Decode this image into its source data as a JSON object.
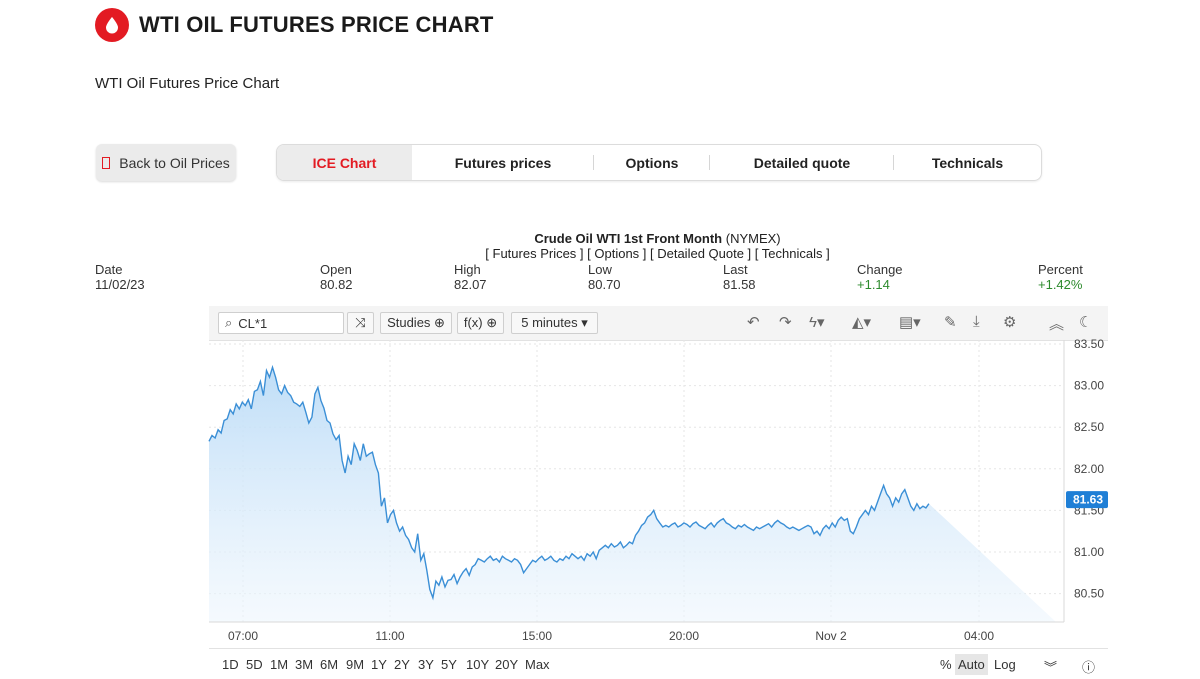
{
  "header": {
    "title": "WTI OIL FUTURES PRICE CHART",
    "subtitle": "WTI Oil Futures Price Chart"
  },
  "nav": {
    "back_label": "Back to Oil Prices",
    "tabs": [
      {
        "label": "ICE Chart",
        "active": true
      },
      {
        "label": "Futures prices",
        "active": false
      },
      {
        "label": "Options",
        "active": false
      },
      {
        "label": "Detailed quote",
        "active": false
      },
      {
        "label": "Technicals",
        "active": false
      }
    ]
  },
  "instrument": {
    "name": "Crude Oil WTI 1st Front Month",
    "exchange": "(NYMEX)",
    "links": "[ Futures Prices ] [ Options ] [ Detailed Quote ] [ Technicals ]"
  },
  "quote": {
    "date_label": "Date",
    "date": "11/02/23",
    "open_label": "Open",
    "open": "80.82",
    "high_label": "High",
    "high": "82.07",
    "low_label": "Low",
    "low": "80.70",
    "last_label": "Last",
    "last": "81.58",
    "change_label": "Change",
    "change": "+1.14",
    "percent_label": "Percent",
    "percent": "+1.42%"
  },
  "toolbar": {
    "symbol": "CL*1",
    "studies_label": "Studies ⊕",
    "fx_label": "f(x) ⊕",
    "interval_label": "5 minutes ▾"
  },
  "bottom": {
    "ranges": [
      "1D",
      "5D",
      "1M",
      "3M",
      "6M",
      "9M",
      "1Y",
      "2Y",
      "3Y",
      "5Y",
      "10Y",
      "20Y",
      "Max"
    ],
    "percent_label": "%",
    "auto_label": "Auto",
    "log_label": "Log"
  },
  "colors": {
    "accent": "#e31b23",
    "line": "#3b8fd6",
    "area": "#cfe5fa",
    "positive": "#2e8b2e"
  },
  "chart_data": {
    "type": "area",
    "x_ticks": [
      "07:00",
      "11:00",
      "15:00",
      "20:00",
      "Nov 2",
      "04:00"
    ],
    "y_ticks": [
      "80.50",
      "81.00",
      "81.50",
      "82.00",
      "82.50",
      "83.00",
      "83.50"
    ],
    "ylim": [
      80.2,
      83.5
    ],
    "last_value": "81.63",
    "x": [
      0,
      2,
      4,
      6,
      8,
      10,
      12,
      14,
      16,
      18,
      20,
      22,
      24,
      26,
      28,
      30,
      32,
      34,
      36,
      38,
      40,
      42,
      44,
      46,
      48,
      50,
      52,
      54,
      56,
      58,
      60,
      62,
      64,
      66,
      68,
      70,
      72,
      74,
      76,
      78,
      80,
      82,
      84,
      86,
      88,
      90,
      92,
      94,
      96,
      98,
      100,
      102,
      104,
      106,
      108,
      110,
      112,
      114,
      116,
      118,
      120,
      122,
      124,
      126,
      128,
      130,
      132,
      134,
      136,
      138,
      140,
      142,
      144,
      146,
      148,
      150,
      152,
      154,
      156,
      158,
      160,
      162,
      164,
      166,
      168,
      170,
      172,
      174,
      176,
      178,
      180,
      182,
      184,
      186,
      188,
      190,
      192,
      194,
      196,
      198,
      200,
      202,
      204,
      206,
      208,
      210,
      212,
      214,
      216,
      218,
      220,
      222,
      224,
      226,
      228,
      230,
      232,
      234,
      236,
      238,
      240,
      242,
      244,
      246,
      248,
      250,
      252,
      254,
      256,
      258,
      260,
      262,
      264,
      266,
      268,
      270,
      272,
      274,
      276,
      278,
      280,
      282,
      284,
      286,
      288,
      290,
      292,
      294,
      296,
      298,
      300,
      302,
      304,
      306,
      308,
      310,
      312,
      314,
      316,
      318,
      320,
      322,
      324,
      326,
      328,
      330,
      332,
      334,
      336,
      338,
      340,
      342,
      344,
      346,
      348,
      350,
      352,
      354,
      356,
      358,
      360,
      362,
      364,
      366,
      368,
      370,
      372,
      374,
      376,
      378,
      380,
      382,
      384,
      386,
      388,
      390,
      392,
      394,
      396,
      398,
      400,
      402,
      404,
      406,
      408,
      410,
      412,
      414,
      416,
      418,
      420,
      422,
      424,
      426,
      428,
      430,
      432,
      434,
      436,
      438,
      440,
      442,
      444,
      446,
      448,
      450,
      452,
      454,
      456,
      458,
      460,
      462,
      464,
      466,
      468,
      470,
      472,
      474,
      476,
      478,
      480,
      482,
      484,
      486,
      488,
      490,
      492,
      494,
      496,
      498,
      500,
      502,
      504,
      506,
      508,
      510,
      512,
      514,
      516,
      518,
      520,
      522,
      524,
      526,
      528,
      530,
      532,
      534,
      536,
      538,
      540,
      542,
      544,
      546,
      548,
      550,
      552,
      554,
      556,
      558,
      560
    ],
    "values": [
      82.33,
      82.4,
      82.37,
      82.47,
      82.43,
      82.58,
      82.6,
      82.71,
      82.66,
      82.78,
      82.72,
      82.8,
      82.76,
      82.83,
      82.72,
      82.93,
      82.95,
      83.05,
      82.88,
      83.18,
      83.1,
      83.22,
      83.1,
      82.95,
      82.9,
      83.0,
      82.92,
      82.88,
      82.8,
      82.78,
      82.75,
      82.8,
      82.68,
      82.55,
      82.62,
      82.9,
      82.98,
      82.82,
      82.73,
      82.58,
      82.55,
      82.42,
      82.35,
      82.4,
      82.1,
      81.95,
      82.15,
      82.05,
      82.3,
      82.22,
      82.1,
      82.3,
      82.15,
      82.18,
      82.2,
      82.05,
      81.95,
      81.55,
      81.65,
      81.35,
      81.45,
      81.5,
      81.35,
      81.25,
      81.3,
      81.2,
      81.15,
      81.05,
      81.0,
      81.22,
      80.9,
      80.98,
      80.78,
      80.55,
      80.45,
      80.65,
      80.6,
      80.7,
      80.58,
      80.66,
      80.67,
      80.73,
      80.62,
      80.7,
      80.76,
      80.8,
      80.72,
      80.82,
      80.85,
      80.92,
      80.9,
      80.88,
      80.92,
      80.95,
      80.9,
      80.92,
      80.88,
      80.95,
      80.92,
      80.9,
      80.88,
      80.92,
      80.9,
      80.85,
      80.75,
      80.8,
      80.85,
      80.9,
      80.88,
      80.92,
      80.95,
      80.9,
      80.92,
      80.95,
      80.9,
      80.88,
      80.92,
      80.9,
      80.95,
      80.92,
      80.98,
      80.95,
      80.92,
      80.95,
      80.9,
      80.98,
      80.95,
      81.0,
      80.92,
      81.02,
      81.05,
      81.08,
      81.05,
      81.1,
      81.06,
      81.08,
      81.12,
      81.05,
      81.08,
      81.12,
      81.1,
      81.2,
      81.25,
      81.32,
      81.35,
      81.42,
      81.45,
      81.5,
      81.4,
      81.35,
      81.3,
      81.32,
      81.3,
      81.33,
      81.35,
      81.3,
      81.32,
      81.35,
      81.33,
      81.3,
      81.34,
      81.36,
      81.32,
      81.3,
      81.28,
      81.32,
      81.35,
      81.3,
      81.35,
      81.38,
      81.4,
      81.35,
      81.33,
      81.3,
      81.28,
      81.32,
      81.3,
      81.33,
      81.3,
      81.28,
      81.26,
      81.3,
      81.28,
      81.3,
      81.32,
      81.34,
      81.3,
      81.35,
      81.38,
      81.35,
      81.33,
      81.3,
      81.28,
      81.3,
      81.28,
      81.26,
      81.28,
      81.3,
      81.32,
      81.3,
      81.22,
      81.25,
      81.2,
      81.28,
      81.32,
      81.28,
      81.35,
      81.3,
      81.38,
      81.42,
      81.38,
      81.4,
      81.25,
      81.22,
      81.3,
      81.4,
      81.45,
      81.5,
      81.45,
      81.55,
      81.5,
      81.6,
      81.7,
      81.8,
      81.7,
      81.65,
      81.55,
      81.65,
      81.6,
      81.7,
      81.75,
      81.65,
      81.55,
      81.5,
      81.58,
      81.52,
      81.55,
      81.53,
      81.58
    ]
  }
}
